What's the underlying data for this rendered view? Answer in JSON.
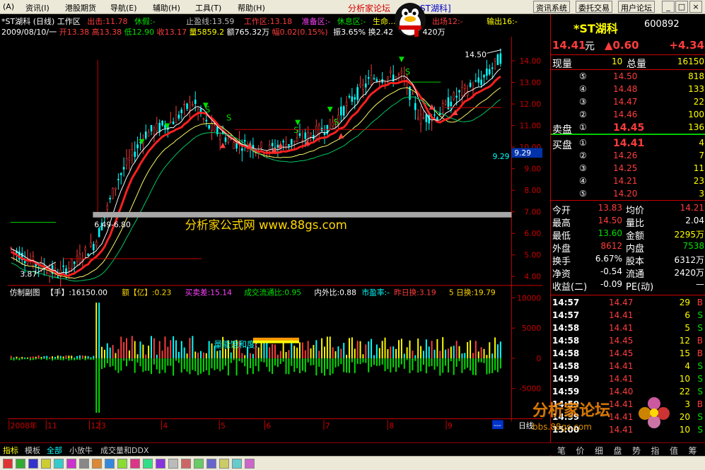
{
  "menu": {
    "items": [
      "资讯(I)",
      "港股期货",
      "导航(E)",
      "辅助(H)",
      "工具(T)",
      "帮助(H)"
    ],
    "leading": "(A)",
    "title_site": "分析家论坛",
    "title_stock": "*ST湖科]",
    "buttons": [
      "资讯系统",
      "委托交易",
      "用户论坛"
    ],
    "win_buttons": [
      "_",
      "□",
      "×"
    ]
  },
  "header": {
    "name": "*ST湖科 (日线) 工作区",
    "chushi": "出击:11.78",
    "xiujia": "休假:-",
    "zhiying": "止盈线:13.59",
    "workzone": "工作区:13.18",
    "prepare": "准备区:-",
    "rest": "休息区:-",
    "life": "生命...",
    "exit": "出场12:-",
    "output": "输出16:-",
    "date": "2009/08/10/一",
    "open": "开13.38",
    "high": "高13.38",
    "low": "低12.90",
    "close": "收13.17",
    "vol": "量5859.2",
    "amt": "额765.32万",
    "chg": "幅0.02(0.15%)",
    "amp": "振3.65%",
    "turn": "换2.42",
    "cap": "420万"
  },
  "chart": {
    "price_axis": [
      "14.00",
      "13.00",
      "12.00",
      "11.00",
      "10.00",
      "9.00",
      "8.00",
      "7.00",
      "6.00",
      "5.00",
      "4.00"
    ],
    "cursor_price": "9.29",
    "high_label": "14.50",
    "low_label": "3.87",
    "mid_label": "6.49-6.80",
    "watermark": "分析家公式网  www.88gs.com",
    "sub_header": {
      "name": "仿制副图",
      "hand": "【手】:16150.00",
      "amount": "额【亿】:0.23",
      "buysell": "买卖差:15.14",
      "turnover": "成交流通比:0.95",
      "inout": "内外比:0.88",
      "pe": "市盈率:-",
      "yest": "昨日换:3.19",
      "fiveday": "5 日换:19.79"
    },
    "vol_axis": [
      "10000",
      "5000",
      "0",
      "-5000"
    ],
    "saturation_label": "量能饱和度:",
    "time_axis": [
      "2008年",
      "11",
      "12",
      "3",
      "4",
      "5",
      "6",
      "7",
      "8",
      "9"
    ],
    "time_tail": "日线"
  },
  "quote": {
    "name": "*ST湖科",
    "code": "600892",
    "price": "14.41",
    "unit": "元",
    "change": "▲0.60",
    "pct": "+4.34",
    "now_vol_label": "现量",
    "now_vol": "10",
    "total_label": "总量",
    "total": "16150",
    "sells": [
      {
        "lv": "⑤",
        "p": "14.50",
        "v": "818"
      },
      {
        "lv": "④",
        "p": "14.48",
        "v": "133"
      },
      {
        "lv": "③",
        "p": "14.47",
        "v": "22"
      },
      {
        "lv": "②",
        "p": "14.46",
        "v": "100"
      },
      {
        "lv": "①",
        "p": "14.45",
        "v": "136",
        "label": "卖盘"
      }
    ],
    "buys": [
      {
        "lv": "①",
        "p": "14.41",
        "v": "4",
        "label": "买盘"
      },
      {
        "lv": "②",
        "p": "14.26",
        "v": "7"
      },
      {
        "lv": "③",
        "p": "14.25",
        "v": "11"
      },
      {
        "lv": "④",
        "p": "14.21",
        "v": "23"
      },
      {
        "lv": "⑤",
        "p": "14.20",
        "v": "3"
      }
    ],
    "stats": [
      {
        "l1": "今开",
        "v1": "13.83",
        "c1": "red",
        "l2": "均价",
        "v2": "14.21",
        "c2": "red"
      },
      {
        "l1": "最高",
        "v1": "14.50",
        "c1": "red",
        "l2": "量比",
        "v2": "2.04",
        "c2": "white"
      },
      {
        "l1": "最低",
        "v1": "13.60",
        "c1": "green",
        "l2": "金额",
        "v2": "2295万",
        "c2": "yellow"
      },
      {
        "l1": "外盘",
        "v1": "8612",
        "c1": "red",
        "l2": "内盘",
        "v2": "7538",
        "c2": "green"
      },
      {
        "l1": "换手",
        "v1": "6.67%",
        "c1": "white",
        "l2": "股本",
        "v2": "6312万",
        "c2": "white"
      },
      {
        "l1": "净资",
        "v1": "-0.54",
        "c1": "white",
        "l2": "流通",
        "v2": "2420万",
        "c2": "white"
      },
      {
        "l1": "收益(二)",
        "v1": "-0.09",
        "c1": "white",
        "l2": "PE(动)",
        "v2": "—",
        "c2": "white"
      }
    ],
    "ticks": [
      {
        "t": "14:57",
        "p": "14.47",
        "v": "29",
        "s": "B"
      },
      {
        "t": "14:57",
        "p": "14.41",
        "v": "6",
        "s": "S"
      },
      {
        "t": "14:58",
        "p": "14.41",
        "v": "5",
        "s": "S"
      },
      {
        "t": "14:58",
        "p": "14.45",
        "v": "12",
        "s": "B"
      },
      {
        "t": "14:58",
        "p": "14.45",
        "v": "15",
        "s": "B"
      },
      {
        "t": "14:58",
        "p": "14.41",
        "v": "4",
        "s": "S"
      },
      {
        "t": "14:59",
        "p": "14.41",
        "v": "10",
        "s": "S"
      },
      {
        "t": "14:59",
        "p": "14.40",
        "v": "22",
        "s": "S"
      },
      {
        "t": "14:59",
        "p": "14.41",
        "v": "3",
        "s": "B"
      },
      {
        "t": "14:59",
        "p": "14.41",
        "v": "20",
        "s": "S"
      },
      {
        "t": "15:00",
        "p": "14.41",
        "v": "10",
        "s": "S"
      }
    ],
    "bottom_tabs": [
      "笔",
      "价",
      "细",
      "盘",
      "势",
      "指",
      "值",
      "筹"
    ]
  },
  "tabs": [
    "指标",
    "模板",
    "全部",
    "小放牛",
    "成交量和DDX"
  ],
  "forum_badge": "分析家论坛",
  "forum_url": "bbs.88gs.com"
}
